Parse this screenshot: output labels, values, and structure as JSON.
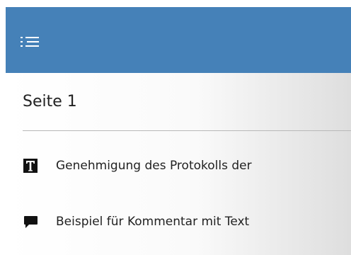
{
  "header": {
    "menu_icon": "hamburger-menu-icon",
    "background_color": "#4581b8"
  },
  "page": {
    "title": "Seite 1"
  },
  "annotations": [
    {
      "icon": "text-annotation-icon",
      "label": "Genehmigung des Protokolls der"
    },
    {
      "icon": "comment-icon",
      "label": "Beispiel für Kommentar mit Text"
    }
  ]
}
